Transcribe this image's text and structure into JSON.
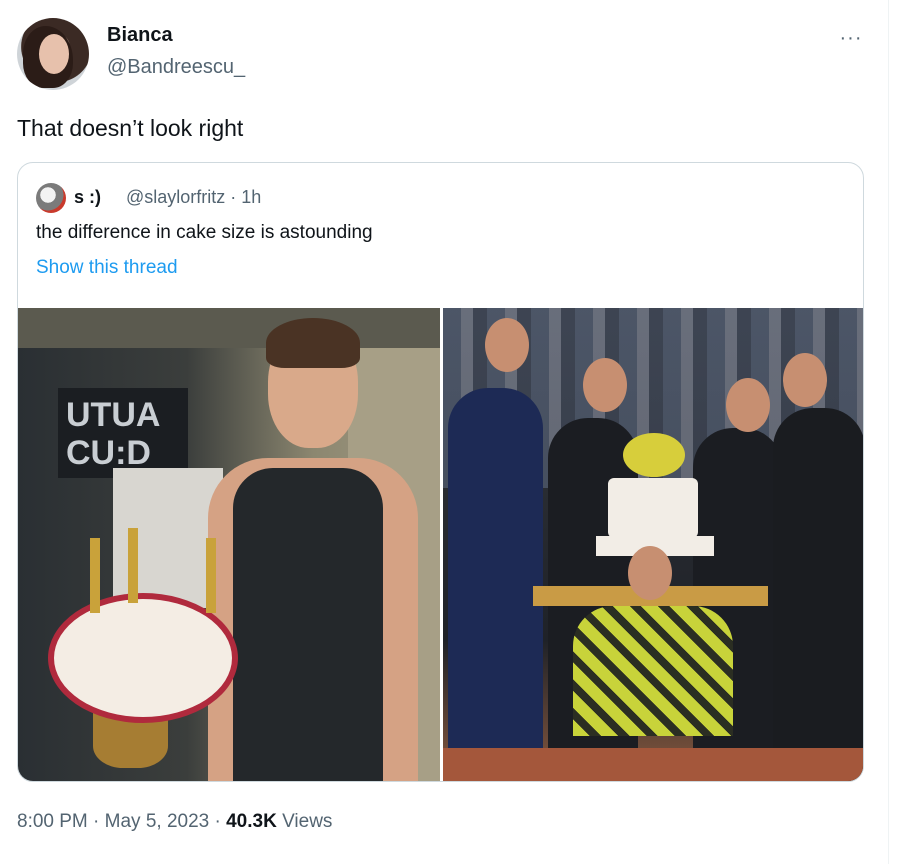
{
  "tweet": {
    "display_name": "Bianca",
    "handle": "@Bandreescu_",
    "more_label": "···",
    "text": "That doesn’t look right",
    "timestamp": "8:00 PM · May 5, 2023 · ",
    "views_count": "40.3K",
    "views_label": " Views"
  },
  "quoted_tweet": {
    "display_name": "s :)",
    "handle_time": "@slaylorfritz · 1h",
    "text": "the difference in cake size is astounding",
    "show_thread_label": "Show this thread",
    "left_photo_sign_text": "UTUA\nCU:D"
  },
  "colors": {
    "text_primary": "#0f1419",
    "text_secondary": "#536471",
    "link": "#1d9bf0",
    "border": "#cfd9de"
  },
  "icons": {
    "more": "more-dots-icon"
  }
}
